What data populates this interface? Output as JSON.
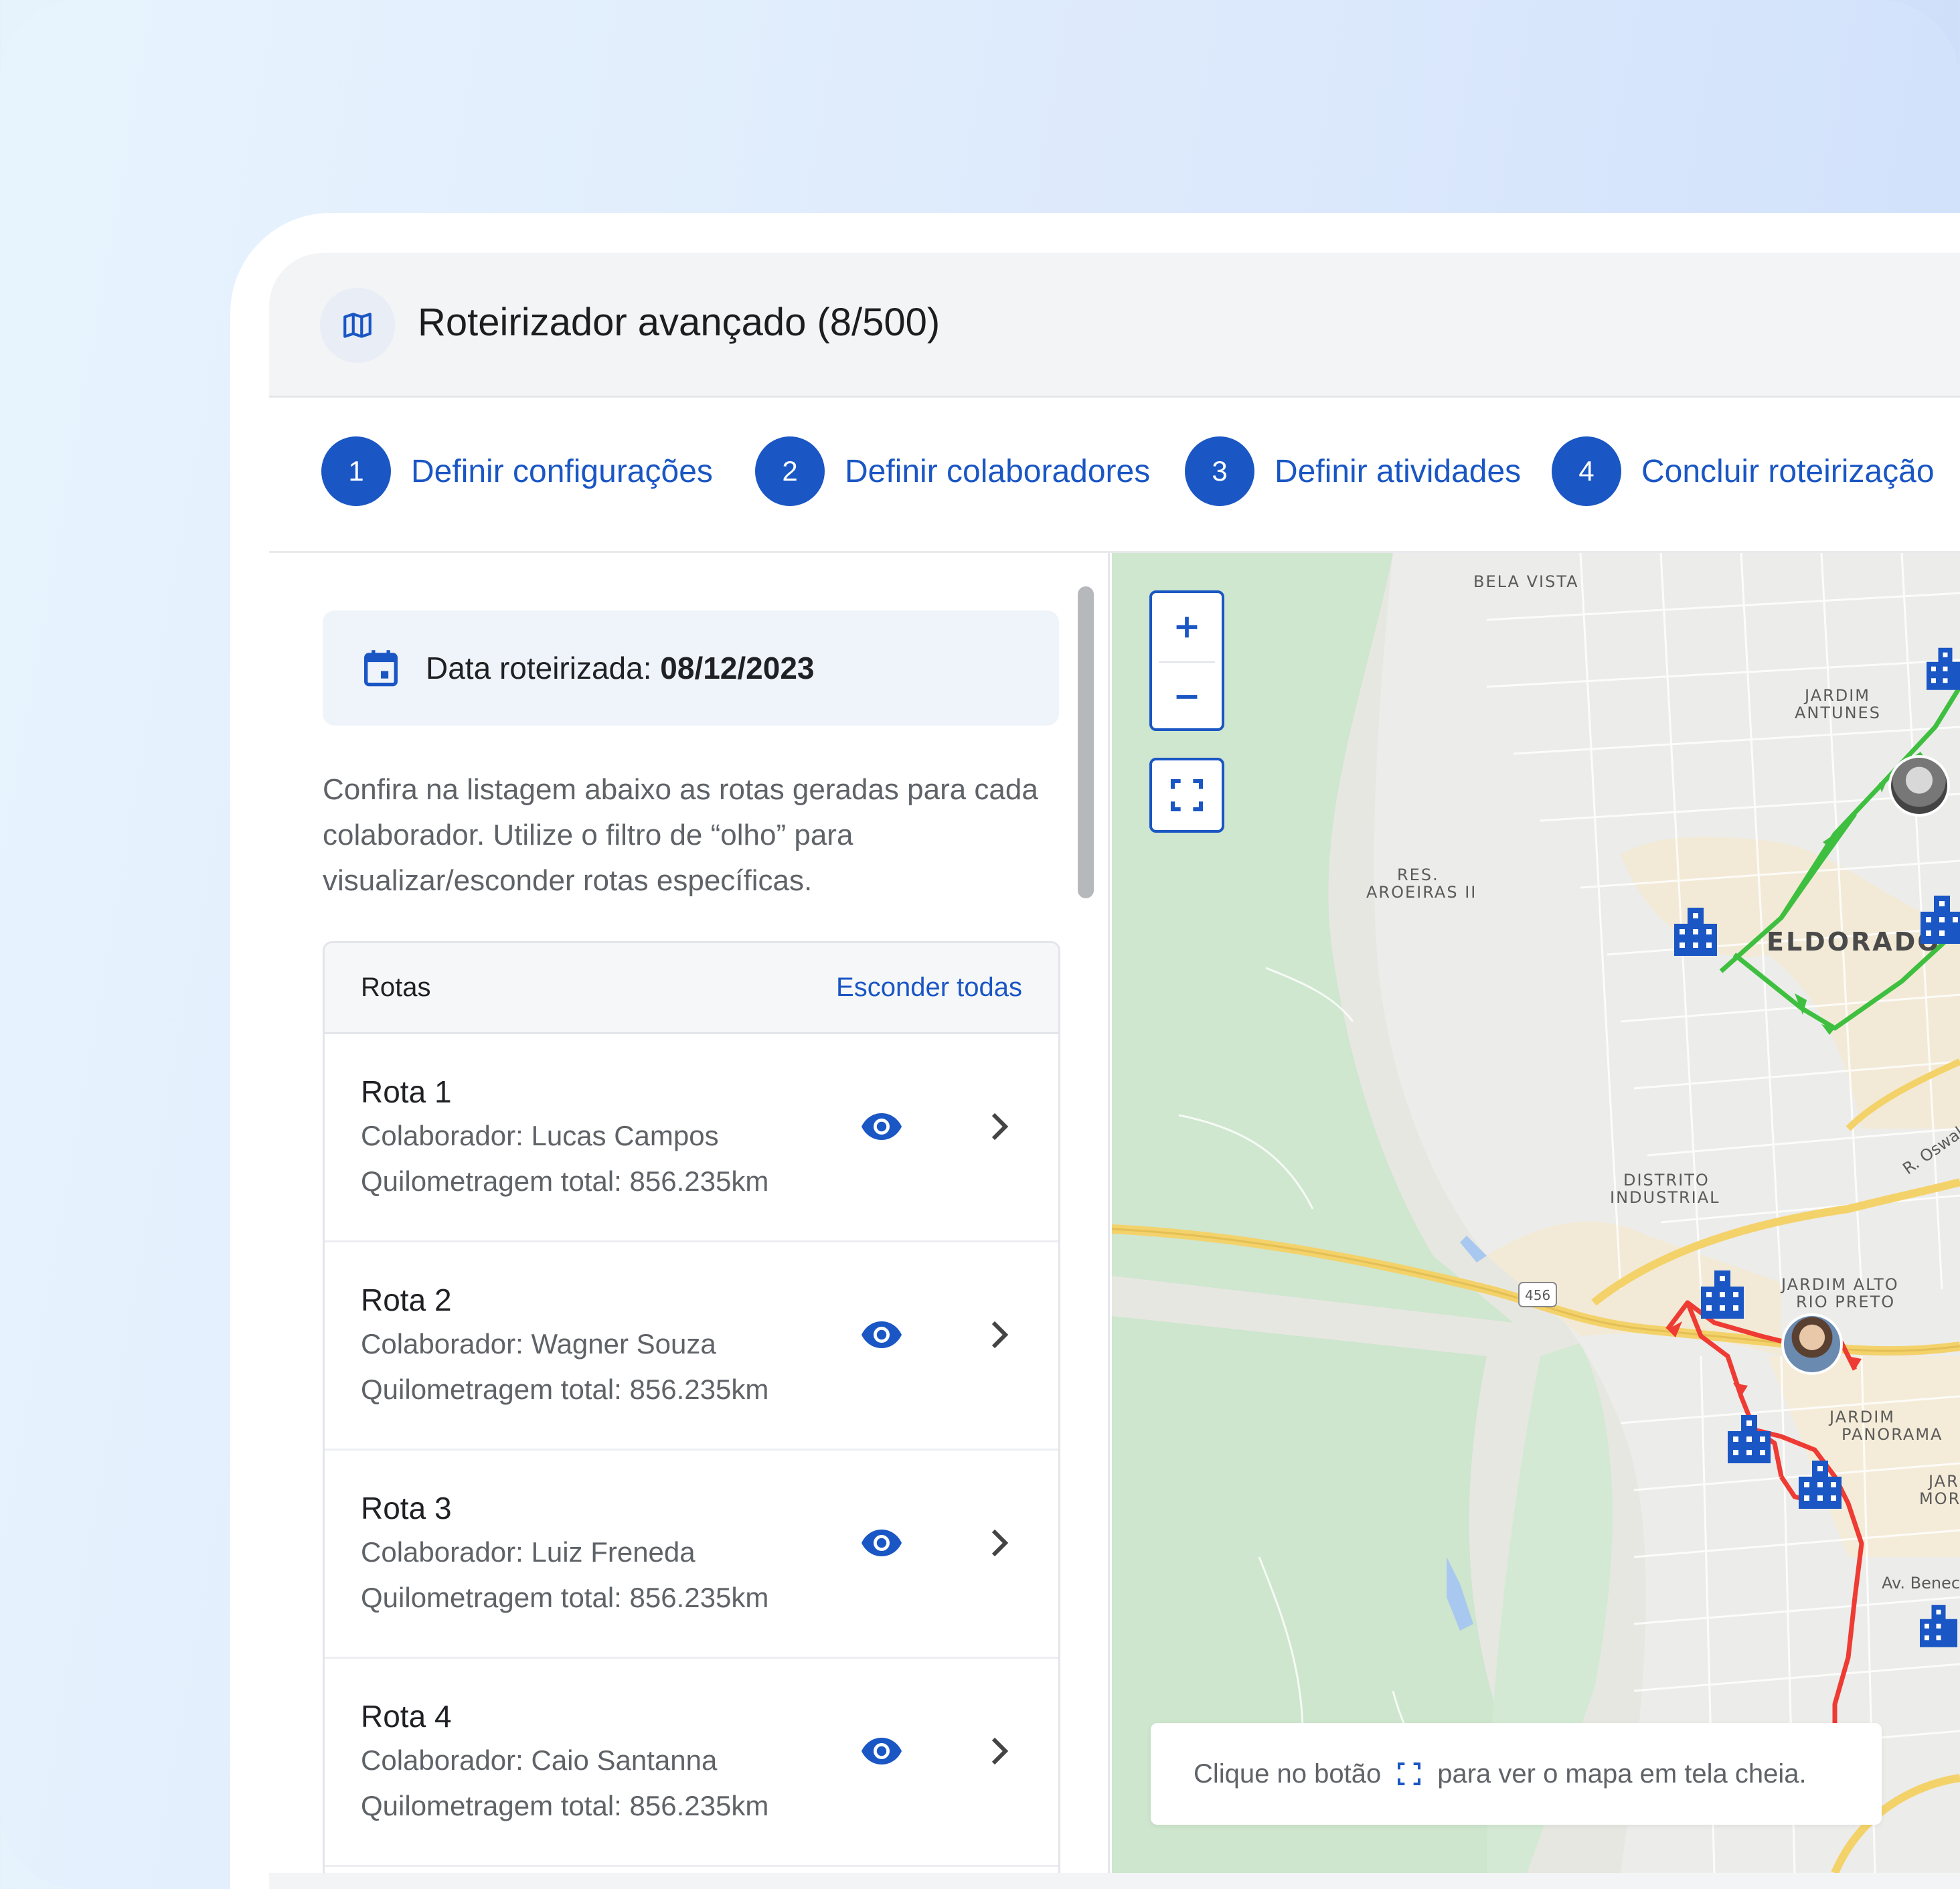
{
  "header": {
    "icon": "map-icon",
    "title": "Roteirizador avançado (8/500)"
  },
  "stepper": [
    {
      "number": "1",
      "label": "Definir configurações"
    },
    {
      "number": "2",
      "label": "Definir colaboradores"
    },
    {
      "number": "3",
      "label": "Definir atividades"
    },
    {
      "number": "4",
      "label": "Concluir roteirização"
    }
  ],
  "date": {
    "icon": "calendar-icon",
    "label": "Data roteirizada: ",
    "value": "08/12/2023"
  },
  "description": "Confira na listagem abaixo as rotas geradas para cada colaborador. Utilize o filtro de “olho” para visualizar/esconder rotas específicas.",
  "routes_table": {
    "header": "Rotas",
    "hide_all": "Esconder todas",
    "routes": [
      {
        "name": "Rota 1",
        "collaborator": "Colaborador: Lucas Campos",
        "distance": "Quilometragem total: 856.235km"
      },
      {
        "name": "Rota 2",
        "collaborator": "Colaborador: Wagner Souza",
        "distance": "Quilometragem total: 856.235km"
      },
      {
        "name": "Rota 3",
        "collaborator": "Colaborador: Luiz Freneda",
        "distance": "Quilometragem total: 856.235km"
      },
      {
        "name": "Rota 4",
        "collaborator": "Colaborador: Caio Santanna",
        "distance": "Quilometragem total: 856.235km"
      }
    ]
  },
  "map": {
    "labels": {
      "bela_vista": "BELA VISTA",
      "jardim_antunes_1": "JARDIM",
      "jardim_antunes_2": "ANTUNES",
      "res_1": "RES.",
      "res_2": "AROEIRAS II",
      "eldorado": "ELDORADO",
      "distrito_1": "DISTRITO",
      "distrito_2": "INDUSTRIAL",
      "jar_alto_1": "JARDIM ALTO",
      "jar_alto_2": "RIO PRETO",
      "panorama_1": "JARDIM",
      "panorama_2": "PANORAMA",
      "jard_1": "JARDI",
      "jard_2": "MORU",
      "highway": "456",
      "street_oswaldo": "R. Oswal",
      "av_bened": "Av. Benec"
    },
    "zoom_in": "+",
    "zoom_out": "−",
    "fullscreen_icon": "fullscreen-icon",
    "hint_before": "Clique no botão",
    "hint_after": "para ver o mapa em tela cheia.",
    "route_colors": {
      "green": "#3fbf3f",
      "red": "#ee3b33"
    },
    "accent": "#1a56c4"
  }
}
